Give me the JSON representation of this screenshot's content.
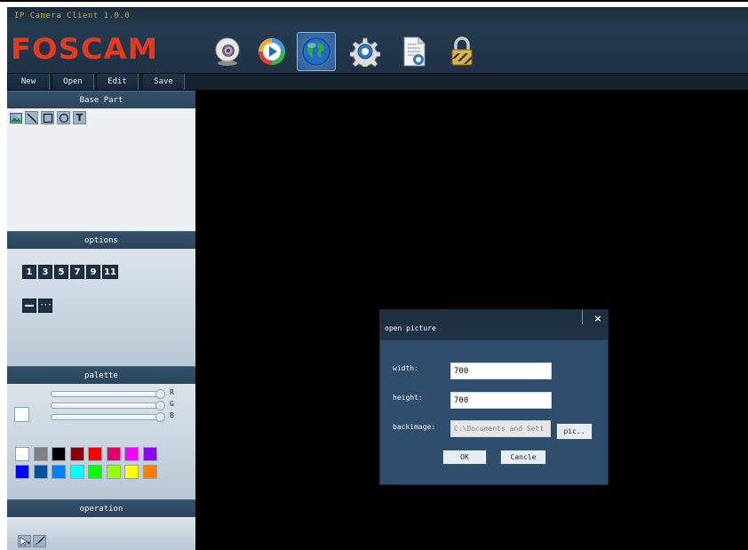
{
  "app": {
    "title": "IP Camera Client 1.0.0",
    "brand": "FOSCAM"
  },
  "toolbar_icons": [
    {
      "name": "camera-icon",
      "active": false
    },
    {
      "name": "playback-icon",
      "active": false
    },
    {
      "name": "globe-icon",
      "active": true
    },
    {
      "name": "gear-icon",
      "active": false
    },
    {
      "name": "document-icon",
      "active": false
    },
    {
      "name": "lock-icon",
      "active": false
    }
  ],
  "menu": {
    "new": "New",
    "open": "Open",
    "edit": "Edit",
    "save": "Save"
  },
  "sidebar": {
    "base_part": {
      "header": "Base Part",
      "tools": [
        "image-tool-icon",
        "line-tool-icon",
        "rectangle-tool-icon",
        "circle-tool-icon",
        "text-tool-icon"
      ],
      "text_tool_glyph": "T"
    },
    "options": {
      "header": "options",
      "line_widths": [
        "1",
        "3",
        "5",
        "7",
        "9",
        "11"
      ],
      "line_styles": [
        "solid-line-icon",
        "dotted-line-icon"
      ],
      "dotted_glyph": "···"
    },
    "palette": {
      "header": "palette",
      "channels": [
        "R",
        "G",
        "B"
      ],
      "current_color": "#ffffff",
      "colors_row1": [
        "#ffffff",
        "#808080",
        "#000000",
        "#8b0000",
        "#ff0000",
        "#e0006e",
        "#ff00ff",
        "#8b00ff"
      ],
      "colors_row2": [
        "#0000ff",
        "#0050a0",
        "#0080ff",
        "#00ffff",
        "#00ff00",
        "#99ff00",
        "#ffff00",
        "#ff8000"
      ]
    },
    "operation": {
      "header": "operation",
      "tools": [
        "add-point-icon",
        "brush-icon"
      ]
    }
  },
  "dialog": {
    "title": "open picture",
    "close": "×",
    "width_label": "width:",
    "width_value": "700",
    "height_label": "height:",
    "height_value": "700",
    "backimage_label": "backimage:",
    "backimage_value": "C:\\Documents and Sett",
    "pic_button": "pic..",
    "ok_button": "OK",
    "cancel_button": "Cancle"
  }
}
